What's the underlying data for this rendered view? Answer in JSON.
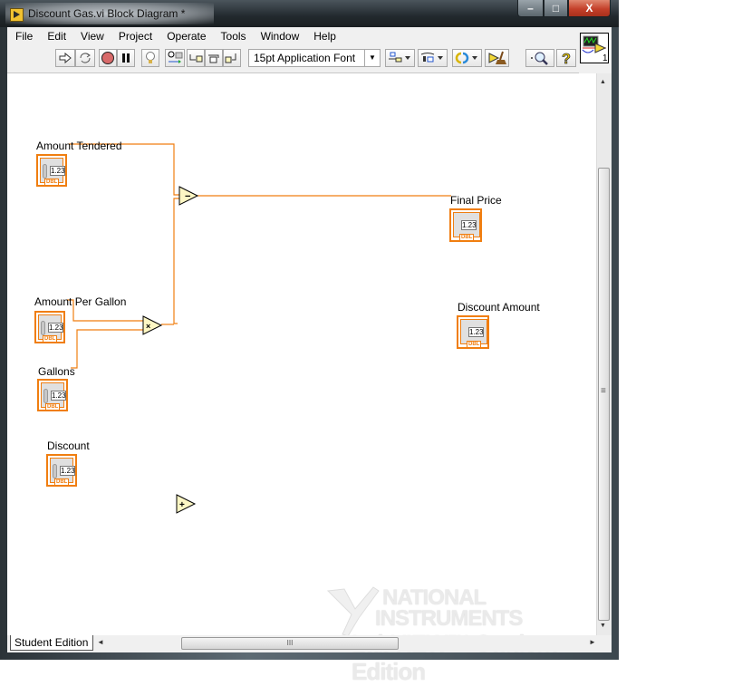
{
  "window": {
    "title": "Discount Gas.vi Block Diagram *",
    "controls": {
      "minimize": "–",
      "maximize": "□",
      "close": "X"
    }
  },
  "menu": [
    "File",
    "Edit",
    "View",
    "Project",
    "Operate",
    "Tools",
    "Window",
    "Help"
  ],
  "toolbar": {
    "buttons": [
      {
        "name": "run",
        "icon": "run-arrow-icon"
      },
      {
        "name": "run-continuously",
        "icon": "run-continuously-icon"
      },
      {
        "name": "abort-execution",
        "icon": "stop-icon"
      },
      {
        "name": "pause",
        "icon": "pause-icon"
      },
      {
        "name": "highlight-execution",
        "icon": "lightbulb-icon"
      },
      {
        "name": "retain-wire-values",
        "icon": "probe-icon"
      },
      {
        "name": "step-into",
        "icon": "step-into-icon"
      },
      {
        "name": "step-over",
        "icon": "step-over-icon"
      },
      {
        "name": "step-out",
        "icon": "step-out-icon"
      },
      {
        "name": "align-objects",
        "icon": "align-icon"
      },
      {
        "name": "distribute-objects",
        "icon": "distribute-icon"
      },
      {
        "name": "reorder",
        "icon": "reorder-icon"
      },
      {
        "name": "clean-up-diagram",
        "icon": "broom-icon"
      },
      {
        "name": "search",
        "icon": "magnifier-icon"
      },
      {
        "name": "context-help",
        "icon": "question-icon"
      }
    ],
    "font_select": "15pt Application Font",
    "connector_pane_number": "1"
  },
  "diagram": {
    "controls": [
      {
        "label": "Amount Tendered",
        "value": "1.23",
        "type": "DBL"
      },
      {
        "label": "Amount Per Gallon",
        "value": "1.23",
        "type": "DBL"
      },
      {
        "label": "Gallons",
        "value": "1.23",
        "type": "DBL"
      },
      {
        "label": "Discount",
        "value": "1.23",
        "type": "DBL"
      }
    ],
    "indicators": [
      {
        "label": "Final Price",
        "value": "1.23",
        "type": "DBL"
      },
      {
        "label": "Discount Amount",
        "value": "1.23",
        "type": "DBL"
      }
    ],
    "functions": [
      {
        "name": "subtract",
        "symbol": "−"
      },
      {
        "name": "multiply",
        "symbol": "×"
      },
      {
        "name": "add",
        "symbol": "+"
      }
    ],
    "wire_color": "#f07e10"
  },
  "watermark": {
    "line1": "NATIONAL",
    "line2": "INSTRUMENTS",
    "line3": "LabVIEW™ Student Edition"
  },
  "status": {
    "tab_label": "Student Edition",
    "hscroll_grip": "III",
    "vscroll_grip": "≡"
  }
}
